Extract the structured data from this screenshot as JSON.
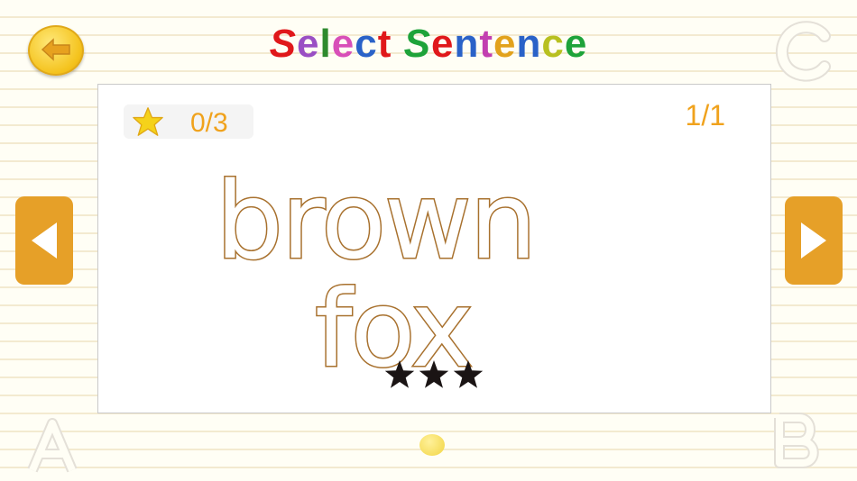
{
  "header": {
    "back_icon": "left-arrow-icon",
    "title_letters": [
      {
        "ch": "S",
        "color": "#e0181b"
      },
      {
        "ch": "e",
        "color": "#9a4fc4"
      },
      {
        "ch": "l",
        "color": "#2e8a2e"
      },
      {
        "ch": "e",
        "color": "#d84fb8"
      },
      {
        "ch": "c",
        "color": "#2a62c8"
      },
      {
        "ch": "t",
        "color": "#e0181b"
      },
      {
        "ch": " ",
        "color": "#000000"
      },
      {
        "ch": "S",
        "color": "#1ea33a"
      },
      {
        "ch": "e",
        "color": "#e0181b"
      },
      {
        "ch": "n",
        "color": "#2a62c8"
      },
      {
        "ch": "t",
        "color": "#c23fb0"
      },
      {
        "ch": "e",
        "color": "#e2a21c"
      },
      {
        "ch": "n",
        "color": "#2a62c8"
      },
      {
        "ch": "c",
        "color": "#b8c020"
      },
      {
        "ch": "e",
        "color": "#1ea33a"
      }
    ]
  },
  "card": {
    "score": "0/3",
    "page_counter": "1/1",
    "sentence_line_1": "brown",
    "sentence_line_2": "fox",
    "stars_total": 3,
    "stars_earned": 0
  },
  "navigation": {
    "prev_icon": "left-triangle-icon",
    "next_icon": "right-triangle-icon"
  },
  "colors": {
    "accent": "#f0a21c",
    "nav_button": "#e6a028",
    "letter_outline": "#a8712e"
  }
}
